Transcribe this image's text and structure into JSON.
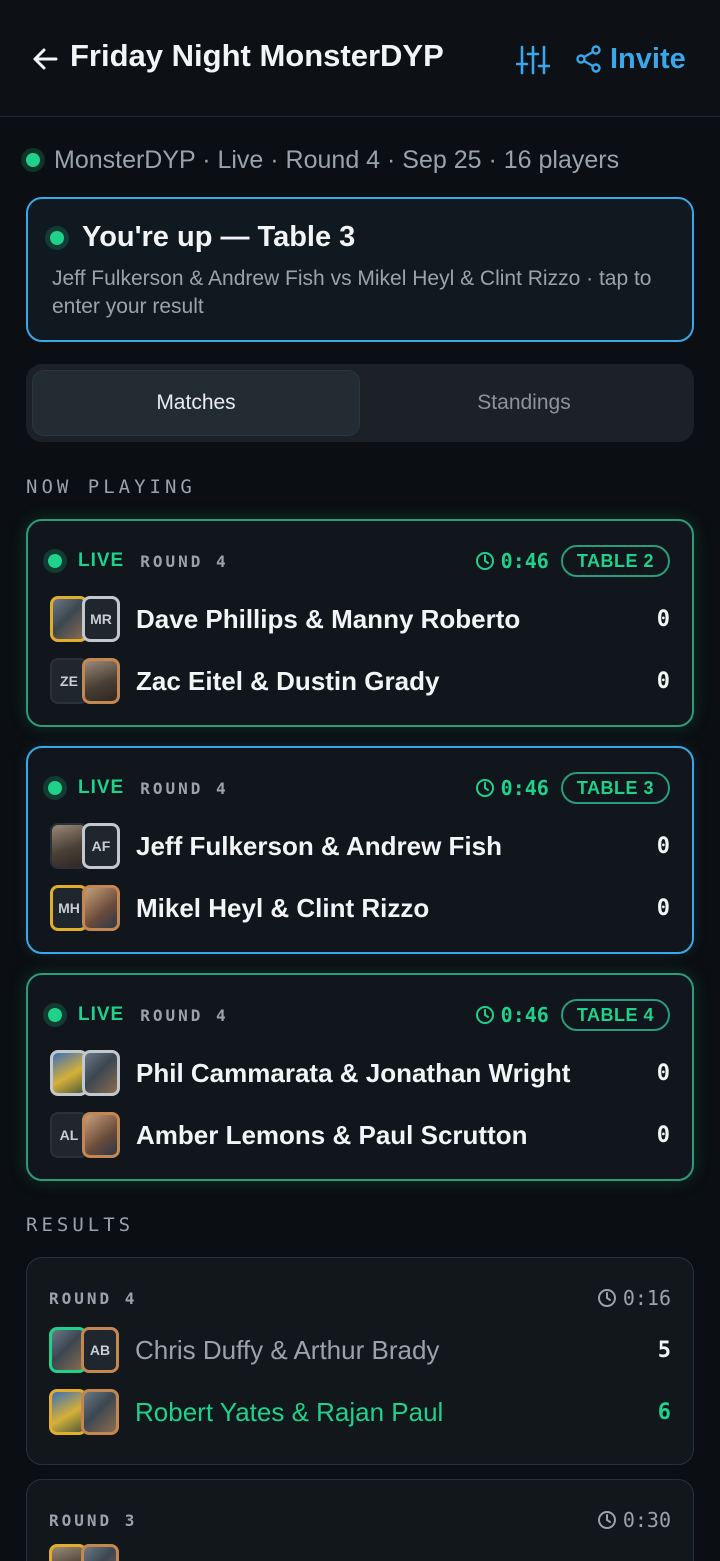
{
  "header": {
    "title": "Friday Night MonsterDYP",
    "invite_label": "Invite"
  },
  "status_line": "MonsterDYP · Live · Round 4 · Sep 25 · 16 players",
  "up_card": {
    "title": "You're up — Table 3",
    "subtitle": "Jeff Fulkerson & Andrew Fish vs Mikel Heyl & Clint Rizzo · tap to enter your result"
  },
  "tabs": [
    {
      "label": "Matches",
      "active": true
    },
    {
      "label": "Standings",
      "active": false
    }
  ],
  "now_playing": {
    "heading": "NOW PLAYING",
    "matches": [
      {
        "status": "LIVE",
        "round": "ROUND 4",
        "timer": "0:46",
        "table": "TABLE 2",
        "teams": [
          {
            "name": "Dave Phillips & Manny Roberto",
            "score": "0",
            "avatars": [
              {
                "initials": ""
              },
              {
                "initials": "MR"
              }
            ]
          },
          {
            "name": "Zac Eitel & Dustin Grady",
            "score": "0",
            "avatars": [
              {
                "initials": "ZE"
              },
              {
                "initials": ""
              }
            ]
          }
        ]
      },
      {
        "status": "LIVE",
        "round": "ROUND 4",
        "timer": "0:46",
        "table": "TABLE 3",
        "teams": [
          {
            "name": "Jeff Fulkerson & Andrew Fish",
            "score": "0",
            "avatars": [
              {
                "initials": ""
              },
              {
                "initials": "AF"
              }
            ]
          },
          {
            "name": "Mikel Heyl & Clint Rizzo",
            "score": "0",
            "avatars": [
              {
                "initials": "MH"
              },
              {
                "initials": ""
              }
            ]
          }
        ]
      },
      {
        "status": "LIVE",
        "round": "ROUND 4",
        "timer": "0:46",
        "table": "TABLE 4",
        "teams": [
          {
            "name": "Phil Cammarata & Jonathan Wright",
            "score": "0",
            "avatars": [
              {
                "initials": ""
              },
              {
                "initials": ""
              }
            ]
          },
          {
            "name": "Amber Lemons & Paul Scrutton",
            "score": "0",
            "avatars": [
              {
                "initials": "AL"
              },
              {
                "initials": ""
              }
            ]
          }
        ]
      }
    ]
  },
  "results": {
    "heading": "RESULTS",
    "matches": [
      {
        "round": "ROUND 4",
        "timer": "0:16",
        "teams": [
          {
            "name": "Chris Duffy & Arthur Brady",
            "score": "5",
            "winner": false,
            "avatars": [
              {
                "initials": ""
              },
              {
                "initials": "AB"
              }
            ]
          },
          {
            "name": "Robert Yates & Rajan Paul",
            "score": "6",
            "winner": true,
            "avatars": [
              {
                "initials": ""
              },
              {
                "initials": ""
              }
            ]
          }
        ]
      },
      {
        "round": "ROUND 3",
        "timer": "0:30",
        "teams": []
      }
    ]
  },
  "colors": {
    "accent_green": "#1fd18a",
    "accent_blue": "#3aa7ea",
    "background": "#0b0e12"
  }
}
